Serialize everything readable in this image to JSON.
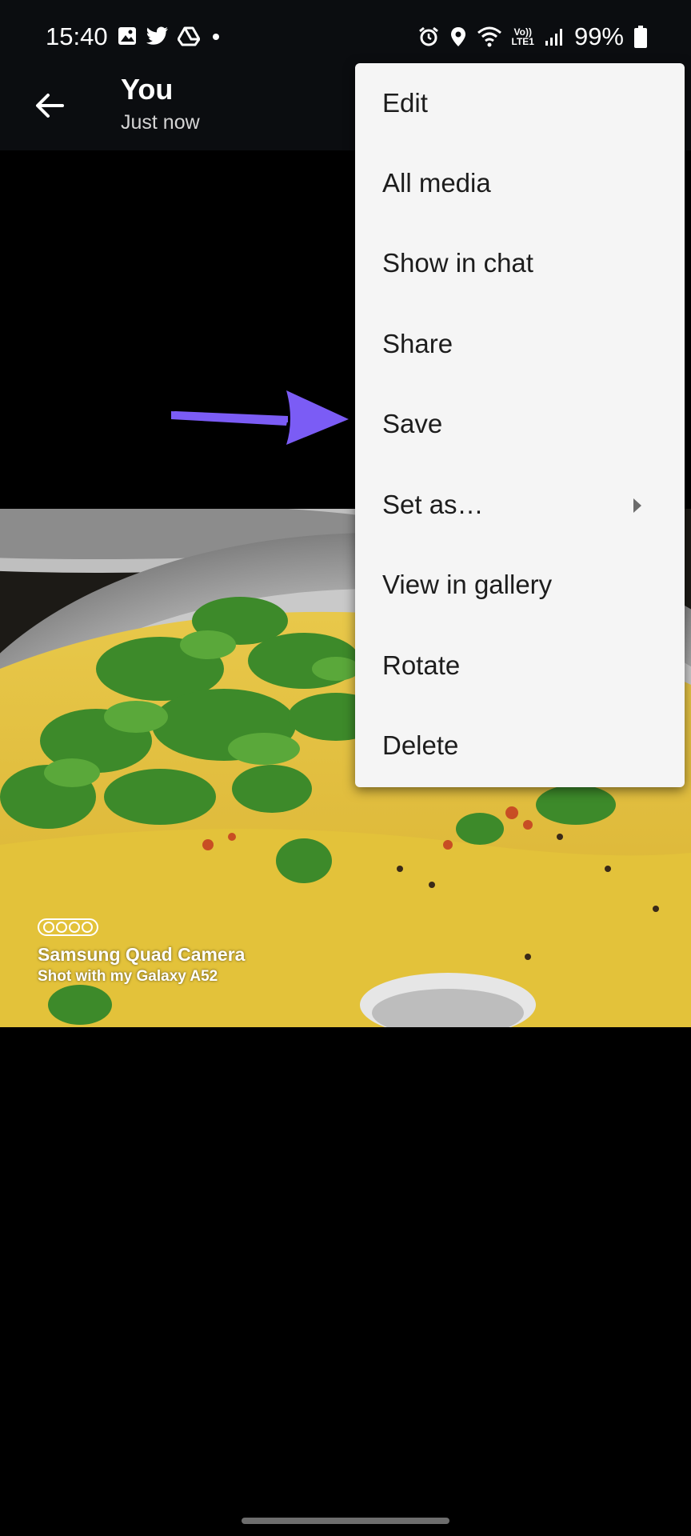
{
  "status_bar": {
    "time": "15:40",
    "battery": "99%",
    "network_top": "Vo))",
    "network_bottom": "LTE1",
    "left_icons": [
      "gallery-icon",
      "twitter-icon",
      "drive-icon",
      "dot-icon"
    ],
    "right_icons": [
      "alarm-icon",
      "location-icon",
      "wifi-icon",
      "volte-icon",
      "signal-icon",
      "battery-icon"
    ]
  },
  "header": {
    "title": "You",
    "subtitle": "Just now",
    "back_icon": "arrow-back-icon"
  },
  "photo": {
    "camera_title": "Samsung Quad Camera",
    "camera_sub": "Shot with my Galaxy A52"
  },
  "menu": {
    "items": [
      {
        "label": "Edit"
      },
      {
        "label": "All media"
      },
      {
        "label": "Show in chat"
      },
      {
        "label": "Share"
      },
      {
        "label": "Save"
      },
      {
        "label": "Set as…"
      },
      {
        "label": "View in gallery"
      },
      {
        "label": "Rotate"
      },
      {
        "label": "Delete"
      }
    ]
  },
  "colors": {
    "menu_bg": "#f5f5f5",
    "arrow": "#7b5cf5",
    "background": "#000000"
  }
}
